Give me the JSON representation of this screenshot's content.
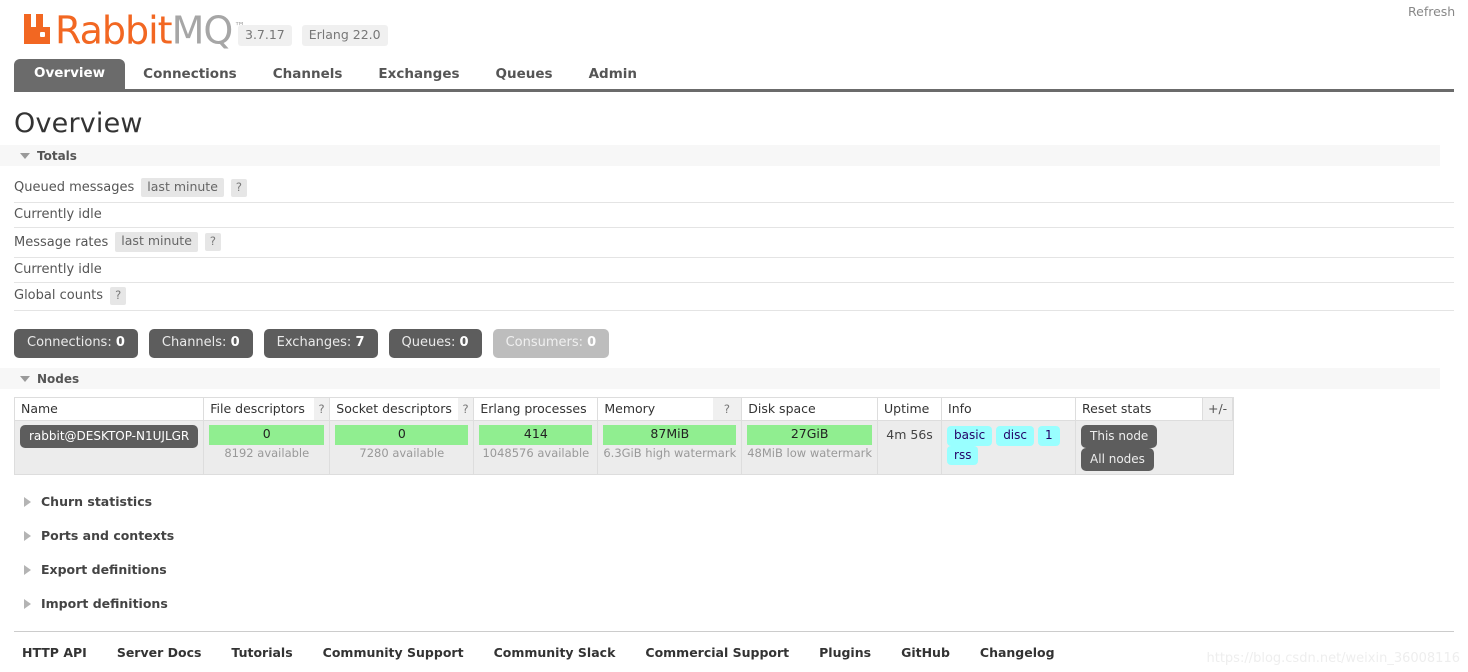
{
  "header": {
    "brand_primary": "Rabbit",
    "brand_secondary": "MQ",
    "trademark": "™",
    "version": "3.7.17",
    "erlang_version": "Erlang 22.0",
    "refresh_label": "Refresh",
    "brand_color": "#f26722",
    "brand_color_secondary": "#a6a6a6"
  },
  "nav": {
    "tabs": [
      {
        "label": "Overview",
        "active": true
      },
      {
        "label": "Connections",
        "active": false
      },
      {
        "label": "Channels",
        "active": false
      },
      {
        "label": "Exchanges",
        "active": false
      },
      {
        "label": "Queues",
        "active": false
      },
      {
        "label": "Admin",
        "active": false
      }
    ]
  },
  "page": {
    "title": "Overview"
  },
  "totals": {
    "section_label": "Totals",
    "queued_messages_label": "Queued messages",
    "queued_messages_chip": "last minute",
    "queued_messages_help": "?",
    "queued_messages_status": "Currently idle",
    "message_rates_label": "Message rates",
    "message_rates_chip": "last minute",
    "message_rates_help": "?",
    "message_rates_status": "Currently idle",
    "global_counts_label": "Global counts",
    "global_counts_help": "?",
    "counts": [
      {
        "label": "Connections:",
        "value": "0",
        "muted": false
      },
      {
        "label": "Channels:",
        "value": "0",
        "muted": false
      },
      {
        "label": "Exchanges:",
        "value": "7",
        "muted": false
      },
      {
        "label": "Queues:",
        "value": "0",
        "muted": false
      },
      {
        "label": "Consumers:",
        "value": "0",
        "muted": true
      }
    ]
  },
  "nodes": {
    "section_label": "Nodes",
    "columns": {
      "name": "Name",
      "file_descriptors": "File descriptors",
      "file_descriptors_help": "?",
      "socket_descriptors": "Socket descriptors",
      "socket_descriptors_help": "?",
      "erlang_processes": "Erlang processes",
      "memory": "Memory",
      "memory_help": "?",
      "disk_space": "Disk space",
      "uptime": "Uptime",
      "info": "Info",
      "reset_stats": "Reset stats",
      "plus_minus": "+/-"
    },
    "row": {
      "name": "rabbit@DESKTOP-N1UJLGR",
      "file_descriptors_value": "0",
      "file_descriptors_sub": "8192 available",
      "socket_descriptors_value": "0",
      "socket_descriptors_sub": "7280 available",
      "erlang_processes_value": "414",
      "erlang_processes_sub": "1048576 available",
      "memory_value": "87MiB",
      "memory_sub": "6.3GiB high watermark",
      "disk_space_value": "27GiB",
      "disk_space_sub": "48MiB low watermark",
      "uptime_value": "4m 56s",
      "info_badges": [
        "basic",
        "disc",
        "1",
        "rss"
      ],
      "reset_buttons": [
        "This node",
        "All nodes"
      ]
    },
    "bar_color": "#90EE90",
    "badge_color": "#99ffff"
  },
  "collapsed_sections": [
    {
      "label": "Churn statistics"
    },
    {
      "label": "Ports and contexts"
    },
    {
      "label": "Export definitions"
    },
    {
      "label": "Import definitions"
    }
  ],
  "footer": {
    "links": [
      "HTTP API",
      "Server Docs",
      "Tutorials",
      "Community Support",
      "Community Slack",
      "Commercial Support",
      "Plugins",
      "GitHub",
      "Changelog"
    ]
  },
  "watermark": {
    "text": "https://blog.csdn.net/weixin_36008116"
  }
}
